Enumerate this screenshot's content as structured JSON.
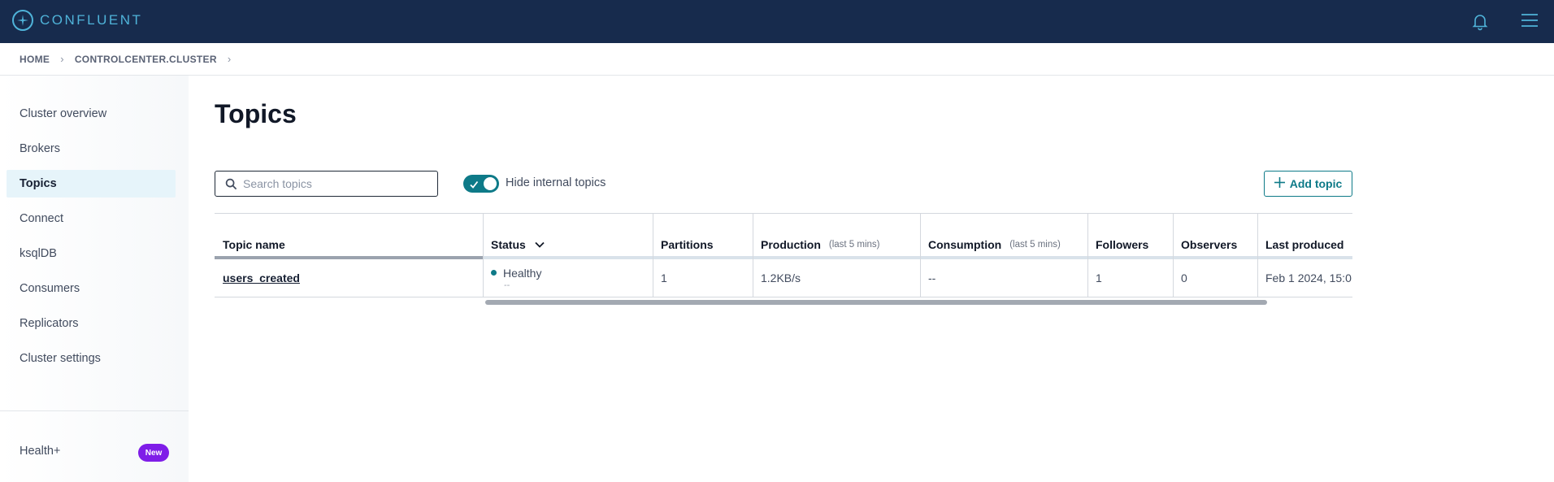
{
  "topbar": {
    "brand": "CONFLUENT",
    "icons": {
      "logo": "confluent-logo-icon",
      "notifications": "bell-icon",
      "menu": "hamburger-menu-icon"
    },
    "colors": {
      "background": "#172b4d",
      "accent": "#4fb3d9"
    }
  },
  "breadcrumb": {
    "items": [
      "HOME",
      "CONTROLCENTER.CLUSTER"
    ],
    "separator": "›"
  },
  "sidebar": {
    "items": [
      {
        "label": "Cluster overview",
        "active": false
      },
      {
        "label": "Brokers",
        "active": false
      },
      {
        "label": "Topics",
        "active": true
      },
      {
        "label": "Connect",
        "active": false
      },
      {
        "label": "ksqlDB",
        "active": false
      },
      {
        "label": "Consumers",
        "active": false
      },
      {
        "label": "Replicators",
        "active": false
      },
      {
        "label": "Cluster settings",
        "active": false
      }
    ],
    "health": {
      "label": "Health+",
      "badge": "New",
      "badge_color": "#7f1de8"
    }
  },
  "main": {
    "title": "Topics",
    "search": {
      "placeholder": "Search topics",
      "value": ""
    },
    "toggle": {
      "label": "Hide internal topics",
      "checked": true,
      "color": "#0e7a88"
    },
    "add_button": {
      "label": "Add topic"
    }
  },
  "table": {
    "columns": [
      {
        "label": "Topic name",
        "sub": ""
      },
      {
        "label": "Status",
        "sub": "",
        "sorted": "descending"
      },
      {
        "label": "Partitions",
        "sub": ""
      },
      {
        "label": "Production",
        "sub": "(last 5 mins)"
      },
      {
        "label": "Consumption",
        "sub": "(last 5 mins)"
      },
      {
        "label": "Followers",
        "sub": ""
      },
      {
        "label": "Observers",
        "sub": ""
      },
      {
        "label": "Last produced",
        "sub": ""
      }
    ],
    "rows": [
      {
        "topic_name": "users_created",
        "status": "Healthy",
        "status_sub": "--",
        "partitions": "1",
        "production": "1.2KB/s",
        "consumption": "--",
        "followers": "1",
        "observers": "0",
        "last_produced": "Feb 1 2024, 15:0"
      }
    ]
  }
}
